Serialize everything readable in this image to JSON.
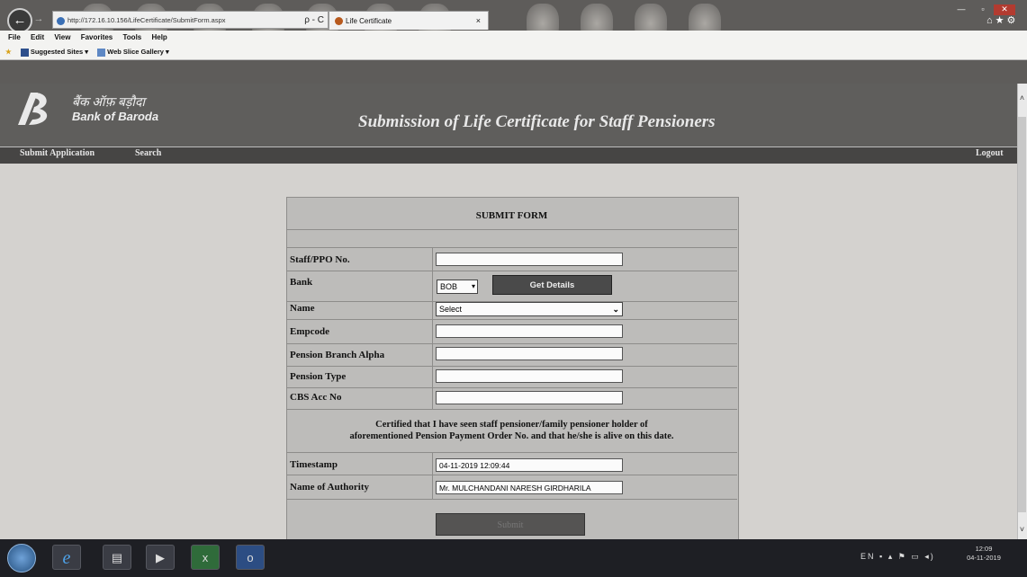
{
  "browser": {
    "address": "http://172.16.10.156/LifeCertificate/SubmitForm.aspx",
    "address_controls": "ρ - C",
    "tab_title": "Life Certificate",
    "tab_close": "×",
    "menu": [
      "File",
      "Edit",
      "View",
      "Favorites",
      "Tools",
      "Help"
    ],
    "favorites": [
      "Suggested Sites ▾",
      "Web Slice Gallery ▾"
    ]
  },
  "header": {
    "bank_hindi": "बैंक ऑफ़ बड़ौदा",
    "bank_name": "Bank of Baroda",
    "title": "Submission of Life Certificate for Staff Pensioners"
  },
  "nav": {
    "submit_application": "Submit Application",
    "search": "Search",
    "logout": "Logout"
  },
  "form": {
    "title": "SUBMIT FORM",
    "labels": {
      "staff_ppo": "Staff/PPO No.",
      "bank": "Bank",
      "name": "Name",
      "empcode": "Empcode",
      "pension_branch": "Pension Branch Alpha",
      "pension_type": "Pension Type",
      "cbs_acc": "CBS Acc No",
      "timestamp": "Timestamp",
      "authority": "Name of Authority"
    },
    "values": {
      "staff_ppo": "",
      "bank": "BOB",
      "name": "Select",
      "empcode": "",
      "pension_branch": "",
      "pension_type": "",
      "cbs_acc": "",
      "timestamp": "04-11-2019 12:09:44",
      "authority": "Mr. MULCHANDANI NARESH GIRDHARILA"
    },
    "get_details": "Get Details",
    "certification_line1": "Certified that I have seen staff pensioner/family pensioner holder of",
    "certification_line2": "aforementioned Pension Payment Order No. and that he/she is alive on this date.",
    "submit": "Submit"
  },
  "taskbar": {
    "tray": "EN ▪ ▴ ⚑ ▭ ◂)",
    "time": "12:09",
    "date": "04-11-2019"
  }
}
